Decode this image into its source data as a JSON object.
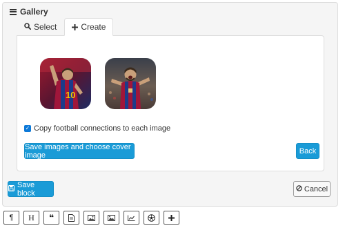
{
  "panel": {
    "title": "Gallery",
    "icon": "bars-icon"
  },
  "tabs": [
    {
      "label": "Select",
      "icon": "search-icon",
      "active": false
    },
    {
      "label": "Create",
      "icon": "plus-icon",
      "active": true
    }
  ],
  "images": [
    {
      "name": "player-thumbnail-1",
      "colors": [
        "#a0163a",
        "#1d3b8a",
        "#f2c400"
      ]
    },
    {
      "name": "player-thumbnail-2",
      "colors": [
        "#a0163a",
        "#1d3b8a",
        "#e8c070"
      ]
    }
  ],
  "checkbox": {
    "label": "Copy football connections to each image",
    "checked": true
  },
  "buttons": {
    "save_images": "Save images and choose cover image",
    "back": "Back",
    "save_block": "Save block",
    "cancel": "Cancel"
  },
  "toolbar": {
    "items": [
      {
        "name": "paragraph-tool",
        "icon": "paragraph-icon",
        "glyph": "¶"
      },
      {
        "name": "heading-tool",
        "icon": "heading-icon",
        "glyph": "H"
      },
      {
        "name": "quote-tool",
        "icon": "quote-icon",
        "glyph": "❝"
      },
      {
        "name": "document-tool",
        "icon": "document-icon",
        "glyph": ""
      },
      {
        "name": "image-tool",
        "icon": "image-icon",
        "glyph": ""
      },
      {
        "name": "gallery-tool",
        "icon": "gallery-icon",
        "glyph": ""
      },
      {
        "name": "chart-tool",
        "icon": "line-chart-icon",
        "glyph": ""
      },
      {
        "name": "football-tool",
        "icon": "football-icon",
        "glyph": ""
      },
      {
        "name": "add-tool",
        "icon": "plus-icon",
        "glyph": "+"
      }
    ]
  },
  "colors": {
    "primary": "#1a9bd7",
    "panel_bg": "#f5f5f5",
    "checkbox": "#0d79d8"
  }
}
